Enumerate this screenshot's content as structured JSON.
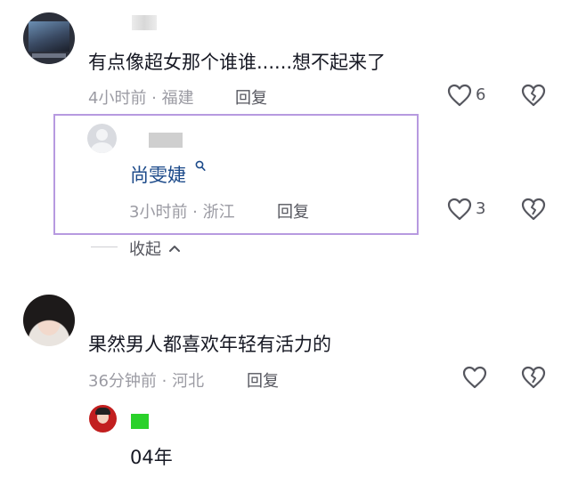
{
  "comments": [
    {
      "text": "有点像超女那个谁谁......想不起来了",
      "meta": "4小时前 · 福建",
      "reply_label": "回复",
      "likes": "6",
      "replies": [
        {
          "mention": "尚雯婕",
          "meta": "3小时前 · 浙江",
          "reply_label": "回复",
          "likes": "3"
        }
      ],
      "collapse_label": "收起"
    },
    {
      "text": "果然男人都喜欢年轻有活力的",
      "meta": "36分钟前 · 河北",
      "reply_label": "回复",
      "likes": "",
      "replies": [
        {
          "text": "04年"
        }
      ]
    }
  ],
  "icons": {
    "like": "heart-outline-icon",
    "dislike": "broken-heart-icon",
    "search": "search-icon",
    "collapse": "chevron-up-icon"
  },
  "colors": {
    "highlight_border": "#b79ae0",
    "mention": "#1c4a8a",
    "meta": "#9b9ba3"
  }
}
